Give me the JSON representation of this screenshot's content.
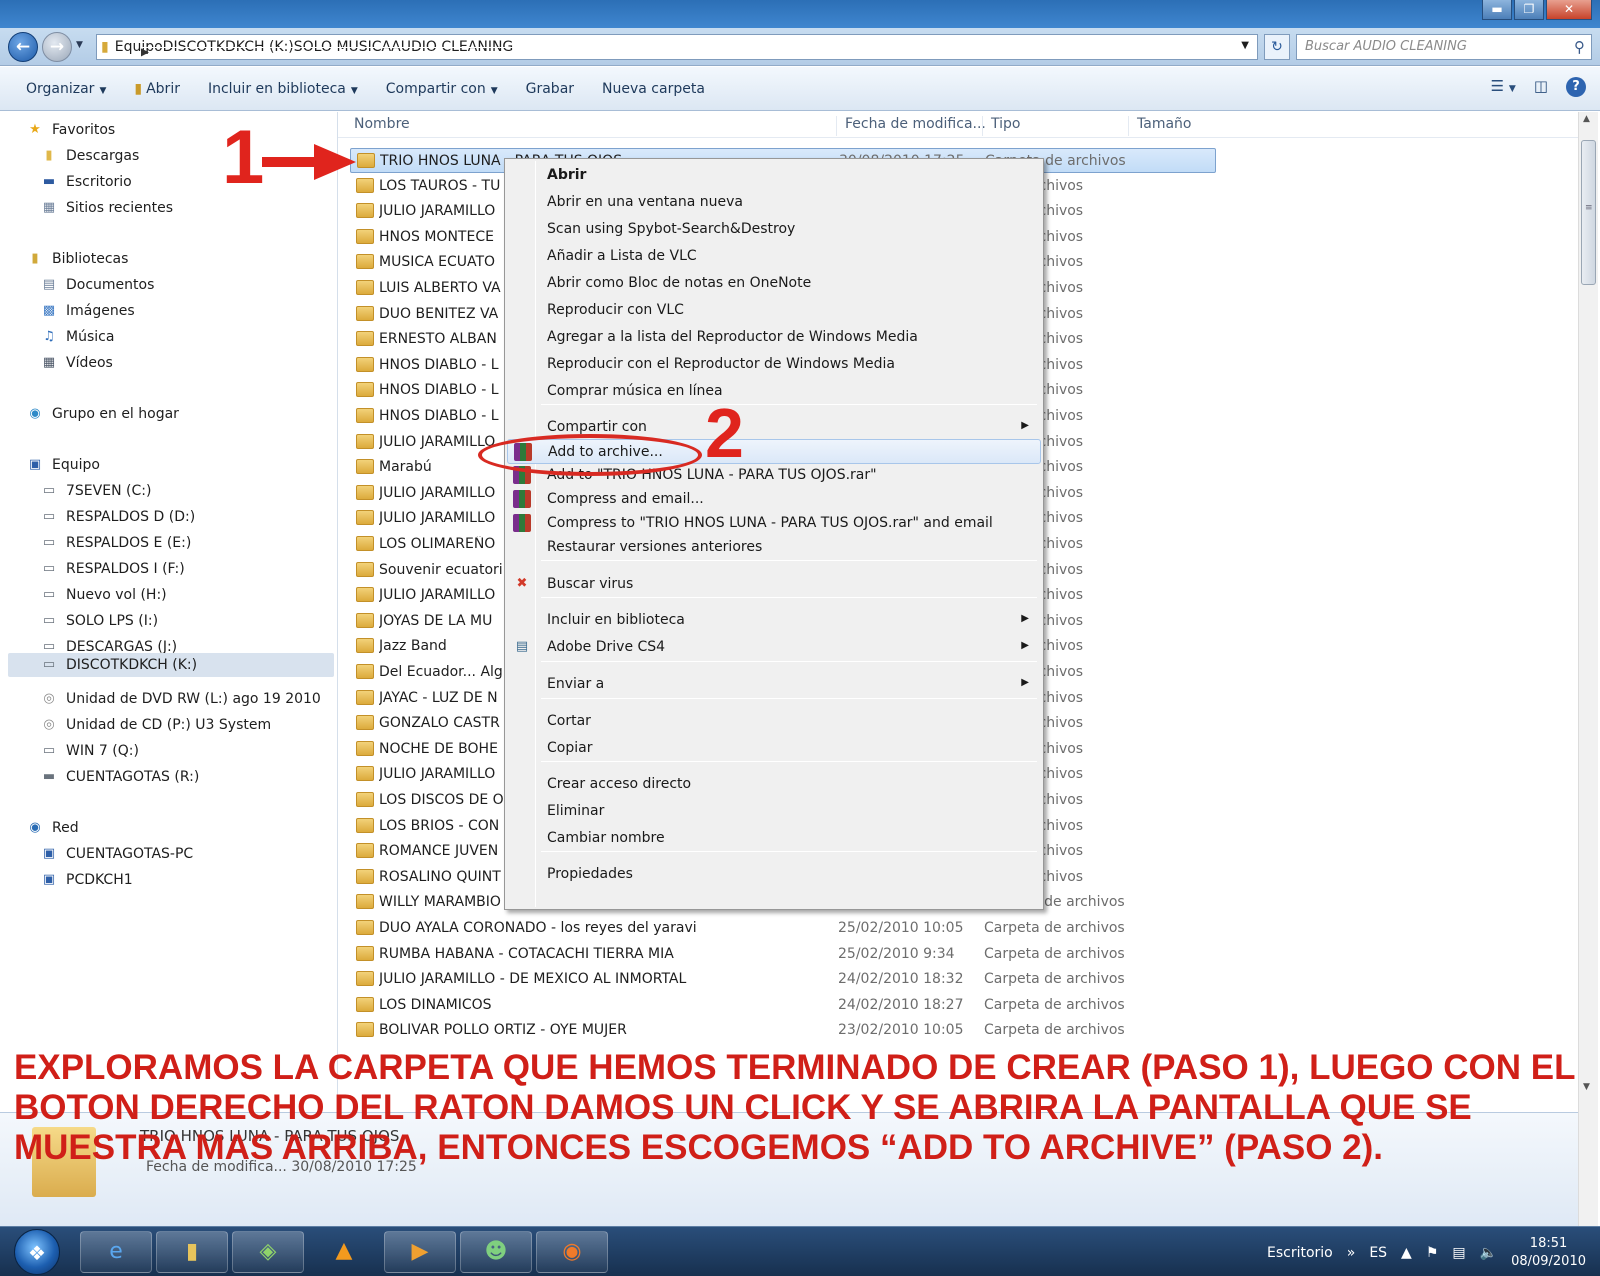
{
  "window": {
    "minimize": "▬",
    "maximize": "❐",
    "close": "✕"
  },
  "address": {
    "crumbs": [
      "Equipo",
      "DISCOTKDKCH (K:)",
      "SOLO MUSICA",
      "AUDIO CLEANING"
    ],
    "search_placeholder": "Buscar AUDIO CLEANING"
  },
  "toolbar": {
    "organize": "Organizar",
    "open": "Abrir",
    "include": "Incluir en biblioteca",
    "share": "Compartir con",
    "burn": "Grabar",
    "new_folder": "Nueva carpeta"
  },
  "nav": {
    "favorites": "Favoritos",
    "downloads": "Descargas",
    "desktop": "Escritorio",
    "recent": "Sitios recientes",
    "libraries": "Bibliotecas",
    "documents": "Documentos",
    "images": "Imágenes",
    "music": "Música",
    "videos": "Vídeos",
    "homegroup": "Grupo en el hogar",
    "computer": "Equipo",
    "drives": [
      "7SEVEN (C:)",
      "RESPALDOS D (D:)",
      "RESPALDOS E (E:)",
      "RESPALDOS I (F:)",
      "Nuevo vol (H:)",
      "SOLO LPS (I:)",
      "DESCARGAS (J:)",
      "DISCOTKDKCH (K:)",
      "Unidad de DVD RW (L:) ago 19 2010",
      "Unidad de CD (P:) U3 System",
      "WIN 7 (Q:)",
      "CUENTAGOTAS (R:)"
    ],
    "network": "Red",
    "pcs": [
      "CUENTAGOTAS-PC",
      "PCDKCH1"
    ]
  },
  "columns": {
    "name": "Nombre",
    "date": "Fecha de modifica...",
    "type": "Tipo",
    "size": "Tamaño"
  },
  "files": [
    {
      "name": "TRIO HNOS LUNA - PARA TUS OJOS",
      "date": "30/08/2010 17:25",
      "type": "Carpeta de archivos"
    },
    {
      "name": "LOS TAUROS - TU",
      "date": "",
      "type": "ta de archivos"
    },
    {
      "name": "JULIO JARAMILLO",
      "date": "",
      "type": "ta de archivos"
    },
    {
      "name": "HNOS MONTECE",
      "date": "",
      "type": "ta de archivos"
    },
    {
      "name": "MUSICA ECUATO",
      "date": "",
      "type": "ta de archivos"
    },
    {
      "name": "LUIS ALBERTO VA",
      "date": "",
      "type": "ta de archivos"
    },
    {
      "name": "DUO BENITEZ VA",
      "date": "",
      "type": "ta de archivos"
    },
    {
      "name": "ERNESTO ALBAN",
      "date": "",
      "type": "ta de archivos"
    },
    {
      "name": "HNOS DIABLO - L",
      "date": "",
      "type": "ta de archivos"
    },
    {
      "name": "HNOS DIABLO - L",
      "date": "",
      "type": "ta de archivos"
    },
    {
      "name": "HNOS DIABLO - L",
      "date": "",
      "type": "ta de archivos"
    },
    {
      "name": "JULIO JARAMILLO",
      "date": "",
      "type": "ta de archivos"
    },
    {
      "name": "Marabú",
      "date": "",
      "type": "ta de archivos"
    },
    {
      "name": "JULIO JARAMILLO",
      "date": "",
      "type": "ta de archivos"
    },
    {
      "name": "JULIO JARAMILLO",
      "date": "",
      "type": "ta de archivos"
    },
    {
      "name": "LOS OLIMAREÑO",
      "date": "",
      "type": "ta de archivos"
    },
    {
      "name": "Souvenir ecuatori",
      "date": "",
      "type": "ta de archivos"
    },
    {
      "name": "JULIO JARAMILLO",
      "date": "",
      "type": "ta de archivos"
    },
    {
      "name": "JOYAS DE LA MU",
      "date": "",
      "type": "ta de archivos"
    },
    {
      "name": "Jazz Band",
      "date": "",
      "type": "ta de archivos"
    },
    {
      "name": "Del Ecuador... Alg",
      "date": "",
      "type": "ta de archivos"
    },
    {
      "name": "JAYAC - LUZ DE N",
      "date": "",
      "type": "ta de archivos"
    },
    {
      "name": "GONZALO CASTR",
      "date": "",
      "type": "ta de archivos"
    },
    {
      "name": "NOCHE DE BOHE",
      "date": "",
      "type": "ta de archivos"
    },
    {
      "name": "JULIO JARAMILLO",
      "date": "",
      "type": "ta de archivos"
    },
    {
      "name": "LOS DISCOS DE O",
      "date": "",
      "type": "ta de archivos"
    },
    {
      "name": "LOS BRIOS - CON",
      "date": "",
      "type": "ta de archivos"
    },
    {
      "name": "ROMANCE JUVEN",
      "date": "",
      "type": "ta de archivos"
    },
    {
      "name": "ROSALINO QUINT",
      "date": "",
      "type": "ta de archivos"
    },
    {
      "name": "WILLY MARAMBIO - LA TROMPETA MAGICA",
      "date": "25/02/2010 10:15",
      "type": "Carpeta de archivos"
    },
    {
      "name": "DUO AYALA CORONADO - los reyes del yaravi",
      "date": "25/02/2010 10:05",
      "type": "Carpeta de archivos"
    },
    {
      "name": "RUMBA HABANA - COTACACHI TIERRA MIA",
      "date": "25/02/2010 9:34",
      "type": "Carpeta de archivos"
    },
    {
      "name": "JULIO JARAMILLO - DE MEXICO AL INMORTAL",
      "date": "24/02/2010 18:32",
      "type": "Carpeta de archivos"
    },
    {
      "name": "LOS DINAMICOS",
      "date": "24/02/2010 18:27",
      "type": "Carpeta de archivos"
    },
    {
      "name": "BOLIVAR POLLO ORTIZ - OYE MUJER",
      "date": "23/02/2010 10:05",
      "type": "Carpeta de archivos"
    }
  ],
  "context_menu": [
    {
      "label": "Abrir",
      "bold": true
    },
    {
      "label": "Abrir en una ventana nueva"
    },
    {
      "label": "Scan using Spybot-Search&Destroy"
    },
    {
      "label": "Añadir a Lista de VLC"
    },
    {
      "label": "Abrir como Bloc de notas en OneNote"
    },
    {
      "label": "Reproducir con VLC"
    },
    {
      "label": "Agregar a la lista del Reproductor de Windows Media"
    },
    {
      "label": "Reproducir con el Reproductor de Windows Media"
    },
    {
      "label": "Comprar música en línea"
    },
    {
      "label": "Compartir con",
      "submenu": true
    },
    {
      "label": "Add to archive...",
      "icon": "winrar-icon",
      "highlighted": true
    },
    {
      "label": "Add to \"TRIO HNOS LUNA - PARA TUS OJOS.rar\"",
      "icon": "winrar-icon"
    },
    {
      "label": "Compress and email...",
      "icon": "winrar-icon"
    },
    {
      "label": "Compress to \"TRIO HNOS LUNA - PARA TUS OJOS.rar\" and email",
      "icon": "winrar-icon"
    },
    {
      "label": "Restaurar versiones anteriores"
    },
    {
      "label": "Buscar virus",
      "icon": "antivirus-icon"
    },
    {
      "label": "Incluir en biblioteca",
      "submenu": true
    },
    {
      "label": "Adobe Drive CS4",
      "icon": "adobe-drive-icon",
      "submenu": true
    },
    {
      "label": "Enviar a",
      "submenu": true
    },
    {
      "label": "Cortar"
    },
    {
      "label": "Copiar"
    },
    {
      "label": "Crear acceso directo"
    },
    {
      "label": "Eliminar"
    },
    {
      "label": "Cambiar nombre"
    },
    {
      "label": "Propiedades"
    }
  ],
  "details": {
    "name": "TRIO HNOS LUNA - PARA TUS OJOS",
    "meta": "Fecha de modifica... 30/08/2010 17:25"
  },
  "annotations": {
    "step1": "1",
    "step2": "2",
    "caption": "EXPLORAMOS LA CARPETA QUE HEMOS TERMINADO DE CREAR (PASO 1), LUEGO CON EL BOTON DERECHO DEL RATON DAMOS UN CLICK Y SE ABRIRA LA PANTALLA QUE SE MUESTRA MAS ARRIBA, ENTONCES ESCOGEMOS “ADD TO ARCHIVE” (PASO 2).",
    "color": "#e0241d"
  },
  "taskbar": {
    "apps": [
      "internet-explorer-icon",
      "explorer-folder-icon",
      "app-green-icon",
      "vlc-icon",
      "media-player-icon",
      "network-people-icon",
      "firefox-icon"
    ],
    "desktop": "Escritorio",
    "lang": "ES",
    "time": "18:51",
    "date": "08/09/2010"
  }
}
